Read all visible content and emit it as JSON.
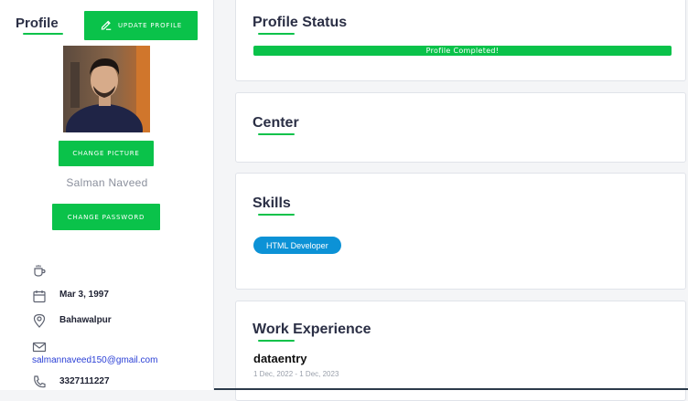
{
  "sidebar": {
    "title": "Profile",
    "update_button": "Update Profile",
    "change_picture_button": "Change Picture",
    "name": "Salman Naveed",
    "change_password_button": "Change Password",
    "info": {
      "icon_1": "coffee-icon",
      "dob": "Mar 3, 1997",
      "location": "Bahawalpur",
      "email": "salmannaveed150@gmail.com",
      "phone": "3327111227"
    }
  },
  "profile_status": {
    "title": "Profile Status",
    "progress_label": "Profile Completed!",
    "progress_percent": 100
  },
  "center": {
    "title": "Center"
  },
  "skills": {
    "title": "Skills",
    "items": [
      "HTML Developer"
    ]
  },
  "work_experience": {
    "title": "Work Experience",
    "jobs": [
      {
        "title": "dataentry",
        "dates": "1 Dec, 2022 - 1 Dec, 2023"
      }
    ]
  },
  "colors": {
    "accent_green": "#0ac24a",
    "skill_blue": "#0c92d6",
    "email_blue": "#2a3fd6"
  }
}
